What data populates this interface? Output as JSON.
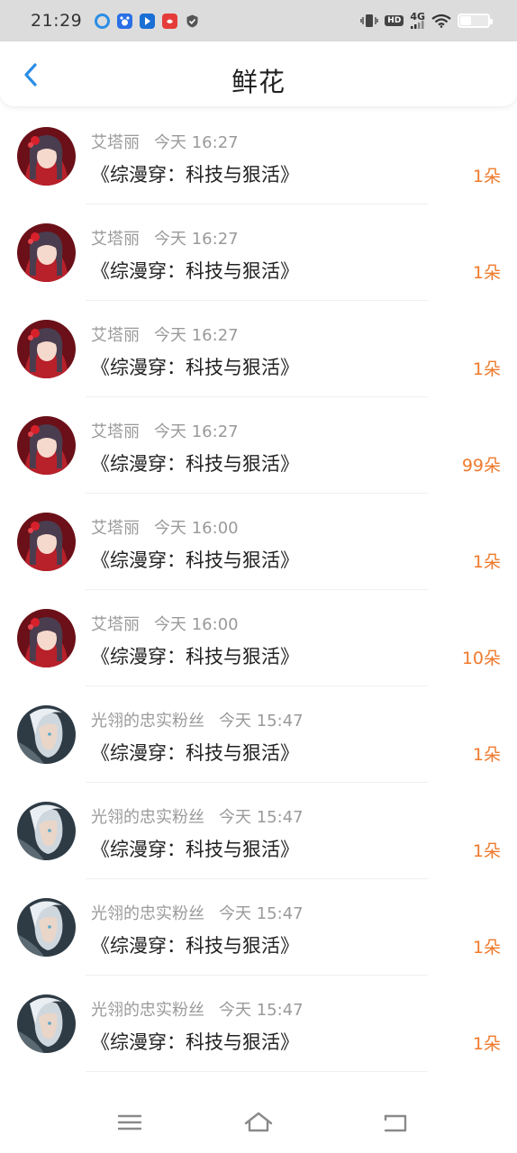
{
  "status_bar": {
    "time": "21:29",
    "network": "4G",
    "hd": "HD",
    "icons": [
      "vibrate-icon",
      "hd-icon",
      "signal-icon",
      "wifi-icon",
      "battery-icon"
    ]
  },
  "header": {
    "title": "鲜花",
    "back_icon": "chevron-left-icon"
  },
  "accent_color": "#f07a2c",
  "items": [
    {
      "user": "艾塔丽",
      "time": "今天 16:27",
      "book": "《综漫穿：科技与狠活》",
      "count": "1朵",
      "avatar": "girl"
    },
    {
      "user": "艾塔丽",
      "time": "今天 16:27",
      "book": "《综漫穿：科技与狠活》",
      "count": "1朵",
      "avatar": "girl"
    },
    {
      "user": "艾塔丽",
      "time": "今天 16:27",
      "book": "《综漫穿：科技与狠活》",
      "count": "1朵",
      "avatar": "girl"
    },
    {
      "user": "艾塔丽",
      "time": "今天 16:27",
      "book": "《综漫穿：科技与狠活》",
      "count": "99朵",
      "avatar": "girl"
    },
    {
      "user": "艾塔丽",
      "time": "今天 16:00",
      "book": "《综漫穿：科技与狠活》",
      "count": "1朵",
      "avatar": "girl"
    },
    {
      "user": "艾塔丽",
      "time": "今天 16:00",
      "book": "《综漫穿：科技与狠活》",
      "count": "10朵",
      "avatar": "girl"
    },
    {
      "user": "光翎的忠实粉丝",
      "time": "今天 15:47",
      "book": "《综漫穿：科技与狠活》",
      "count": "1朵",
      "avatar": "knight"
    },
    {
      "user": "光翎的忠实粉丝",
      "time": "今天 15:47",
      "book": "《综漫穿：科技与狠活》",
      "count": "1朵",
      "avatar": "knight"
    },
    {
      "user": "光翎的忠实粉丝",
      "time": "今天 15:47",
      "book": "《综漫穿：科技与狠活》",
      "count": "1朵",
      "avatar": "knight"
    },
    {
      "user": "光翎的忠实粉丝",
      "time": "今天 15:47",
      "book": "《综漫穿：科技与狠活》",
      "count": "1朵",
      "avatar": "knight"
    }
  ],
  "nav": [
    "menu-icon",
    "home-icon",
    "back-icon"
  ]
}
